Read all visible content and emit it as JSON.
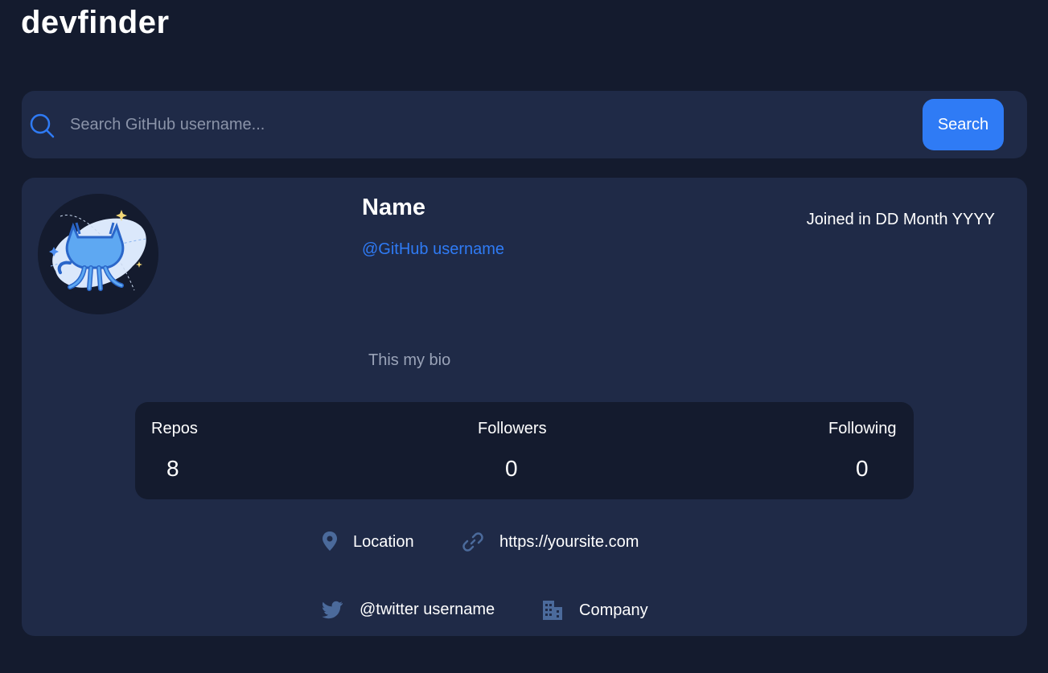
{
  "app": {
    "title": "devfinder"
  },
  "search": {
    "placeholder": "Search GitHub username...",
    "value": "",
    "button_label": "Search"
  },
  "profile": {
    "name": "Name",
    "login": "@GitHub username",
    "joined": "Joined in DD Month YYYY",
    "bio": "This my bio"
  },
  "stats": {
    "repos_label": "Repos",
    "repos_value": "8",
    "followers_label": "Followers",
    "followers_value": "0",
    "following_label": "Following",
    "following_value": "0"
  },
  "links": {
    "location": "Location",
    "blog": "https://yoursite.com",
    "twitter": "@twitter username",
    "company": "Company"
  },
  "colors": {
    "page_background": "#141b2e",
    "card_background": "#1f2a47",
    "accent": "#2f7bf5",
    "icon_muted": "#4b6a9b",
    "text_secondary": "#9aa3b8"
  },
  "icons": {
    "search": "search-icon",
    "avatar": "octocat-avatar",
    "location": "location-pin-icon",
    "blog": "link-icon",
    "twitter": "twitter-icon",
    "company": "building-icon"
  }
}
